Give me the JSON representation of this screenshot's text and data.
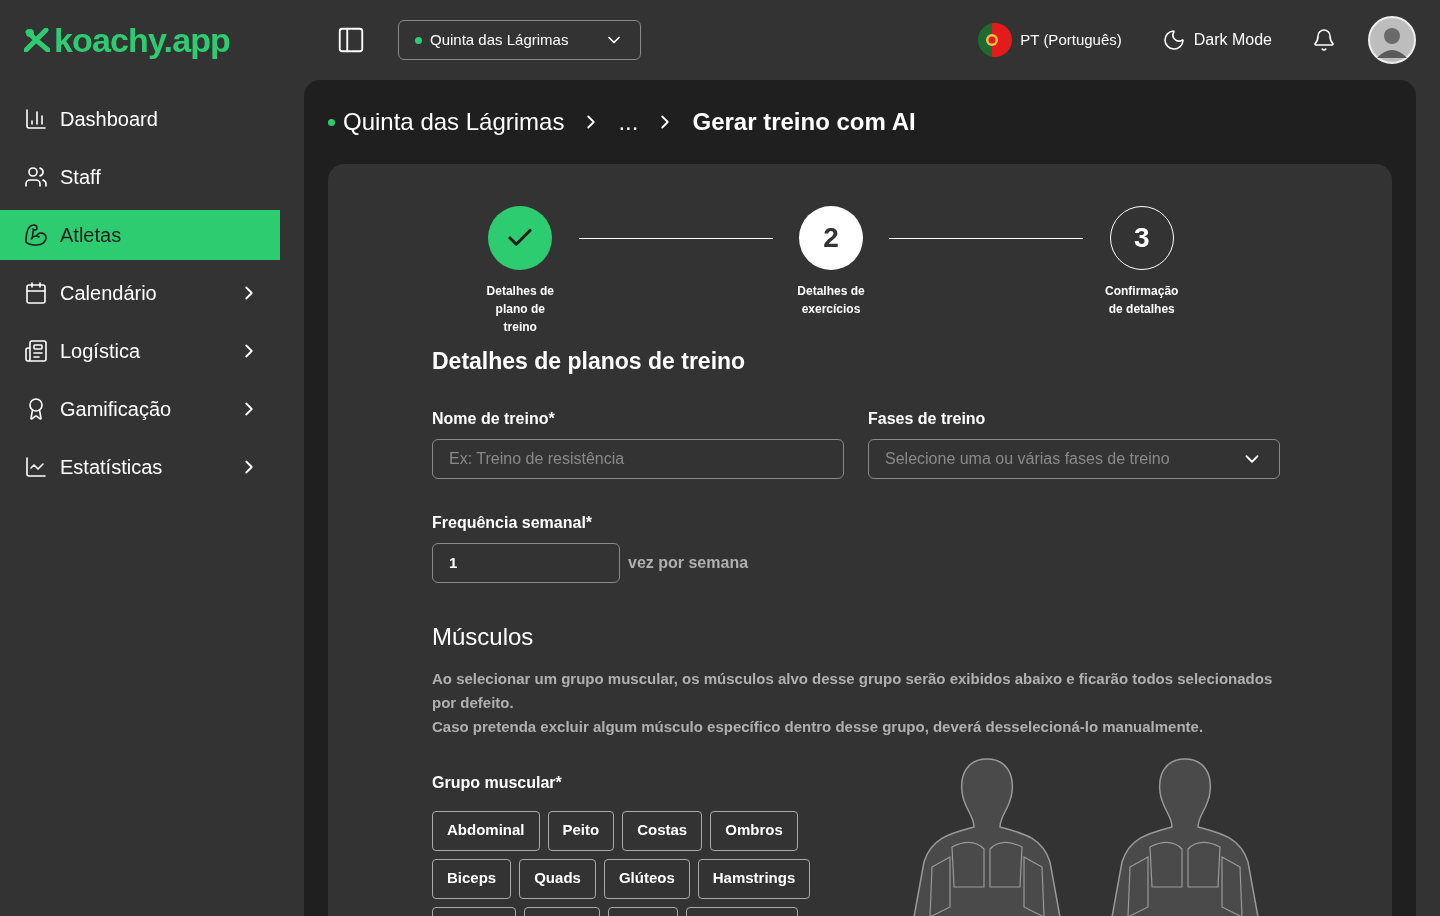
{
  "brand": {
    "logo_text": "koachy.app"
  },
  "header": {
    "club_selector": {
      "label": "Quinta das Lágrimas"
    },
    "language": "PT (Português)",
    "dark_mode": "Dark Mode"
  },
  "sidebar": {
    "items": [
      {
        "label": "Dashboard",
        "selected": false,
        "expandable": false
      },
      {
        "label": "Staff",
        "selected": false,
        "expandable": false
      },
      {
        "label": "Atletas",
        "selected": true,
        "expandable": false
      },
      {
        "label": "Calendário",
        "selected": false,
        "expandable": true
      },
      {
        "label": "Logística",
        "selected": false,
        "expandable": true
      },
      {
        "label": "Gamificação",
        "selected": false,
        "expandable": true
      },
      {
        "label": "Estatísticas",
        "selected": false,
        "expandable": true
      }
    ]
  },
  "breadcrumb": [
    "Quinta das Lágrimas",
    "...",
    "Gerar treino com AI"
  ],
  "steps": [
    {
      "label": "Detalhes de plano de treino",
      "kind": "done"
    },
    {
      "marker": "2",
      "label": "Detalhes de exercícios",
      "kind": "current"
    },
    {
      "marker": "3",
      "label": "Confirmação de detalhes",
      "kind": "pending"
    }
  ],
  "form": {
    "title": "Detalhes de planos de treino",
    "name_field": {
      "label": "Nome de treino*",
      "placeholder": "Ex: Treino de resistência"
    },
    "phases_field": {
      "label": "Fases de treino",
      "placeholder": "Selecione uma ou várias fases de treino"
    },
    "frequency_field": {
      "label": "Frequência semanal*",
      "value": "1",
      "suffix": "vez por semana"
    }
  },
  "muscles": {
    "title": "Músculos",
    "description": [
      "Ao selecionar um grupo muscular, os músculos alvo desse grupo serão exibidos abaixo e ficarão todos selecionados por defeito.",
      "Caso pretenda excluir algum músculo específico dentro desse grupo, deverá desselecioná-lo manualmente."
    ],
    "group_label": "Grupo muscular*",
    "groups": [
      [
        "Abdominal",
        "Peito",
        "Costas",
        "Ombros"
      ],
      [
        "Biceps",
        "Quads",
        "Glúteos",
        "Hamstrings"
      ]
    ]
  }
}
